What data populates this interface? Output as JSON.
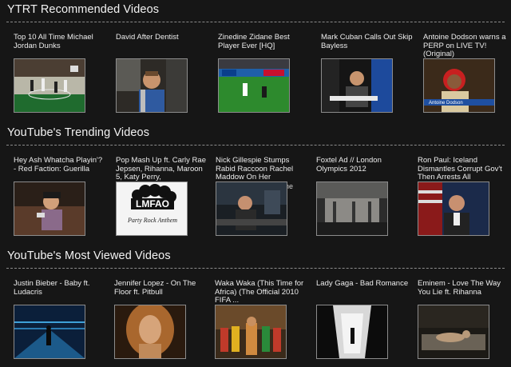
{
  "sections": [
    {
      "title": "YTRT Recommended Videos",
      "videos": [
        {
          "caption": "Top 10 All Time Michael Jordan Dunks",
          "thumb": "basketball-court"
        },
        {
          "caption": "David After Dentist",
          "thumb": "boy-in-car"
        },
        {
          "caption": "Zinedine Zidane Best Player Ever [HQ]",
          "thumb": "soccer-stadium"
        },
        {
          "caption": "Mark Cuban Calls Out Skip Bayless",
          "thumb": "tv-interview"
        },
        {
          "caption": "Antoine Dodson warns a PERP on LIVE TV! (Original)",
          "thumb": "news-interview",
          "overlay": "Antoine Dodson"
        }
      ]
    },
    {
      "title": "YouTube's Trending Videos",
      "videos": [
        {
          "caption": "Hey Ash Whatcha Playin'? - Red Faction: Guerilla",
          "thumb": "couch-gamer"
        },
        {
          "caption": "Pop Mash Up ft. Carly Rae Jepsen, Rihanna, Maroon 5, Katy Perry,",
          "thumb": "lmfao-logo",
          "logo_text": "LMFAO",
          "logo_subtext": "Party Rock Anthem"
        },
        {
          "caption": "Nick Gillespie Stumps Rabid Raccoon Rachel Maddow On Her",
          "thumb": "tv-studio",
          "stray": "ne"
        },
        {
          "caption": "Foxtel Ad // London Olympics 2012",
          "thumb": "industrial-scene"
        },
        {
          "caption": "Ron Paul: Iceland Dismantles Corrupt Gov't Then Arrests All",
          "thumb": "news-anchor"
        }
      ]
    },
    {
      "title": "YouTube's Most Viewed Videos",
      "videos": [
        {
          "caption": "Justin Bieber - Baby ft. Ludacris",
          "thumb": "blue-dance-floor"
        },
        {
          "caption": "Jennifer Lopez - On The Floor ft. Pitbull",
          "thumb": "golden-portrait"
        },
        {
          "caption": "Waka Waka (This Time for Africa) (The Official 2010 FIFA ...",
          "thumb": "stage-performers"
        },
        {
          "caption": "Lady Gaga - Bad Romance",
          "thumb": "white-room"
        },
        {
          "caption": "Eminem - Love The Way You Lie ft. Rihanna",
          "thumb": "dark-bedroom"
        }
      ]
    }
  ]
}
